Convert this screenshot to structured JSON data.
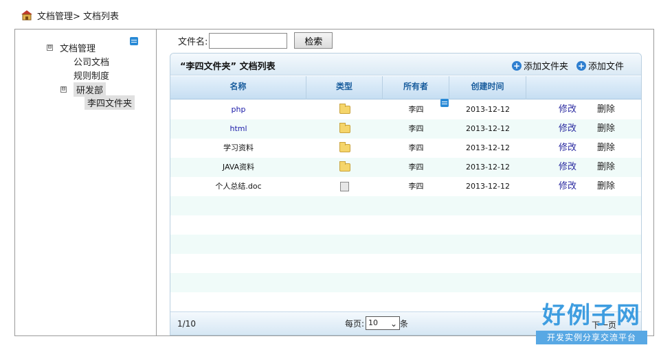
{
  "breadcrumb": {
    "text": "文档管理> 文档列表"
  },
  "tree": {
    "root": "文档管理",
    "children": [
      "公司文档",
      "规则制度",
      "研发部"
    ],
    "subchild": "李四文件夹",
    "collapse_glyph": "⊟"
  },
  "search": {
    "label": "文件名:",
    "value": "",
    "button": "检索"
  },
  "panel": {
    "title": "“李四文件夹” 文档列表",
    "add_folder": "添加文件夹",
    "add_file": "添加文件"
  },
  "table": {
    "headers": [
      "名称",
      "类型",
      "所有者",
      "创建时间",
      ""
    ],
    "rows": [
      {
        "name": "php",
        "type": "folder",
        "owner": "李四",
        "date": "2013-12-12",
        "edit": "修改",
        "delete": "删除"
      },
      {
        "name": "html",
        "type": "folder",
        "owner": "李四",
        "date": "2013-12-12",
        "edit": "修改",
        "delete": "删除"
      },
      {
        "name": "学习资料",
        "type": "folder",
        "owner": "李四",
        "date": "2013-12-12",
        "edit": "修改",
        "delete": "删除"
      },
      {
        "name": "JAVA资料",
        "type": "folder",
        "owner": "李四",
        "date": "2013-12-12",
        "edit": "修改",
        "delete": "删除"
      },
      {
        "name": "个人总结.doc",
        "type": "file",
        "owner": "李四",
        "date": "2013-12-12",
        "edit": "修改",
        "delete": "删除"
      }
    ]
  },
  "pager": {
    "info": "1/10",
    "per_page_label": "每页:",
    "per_page_value": "10",
    "per_page_suffix": "条",
    "next": "下一页"
  },
  "logo": {
    "big": "好例子网",
    "small": "开发实例分享交流平台"
  }
}
